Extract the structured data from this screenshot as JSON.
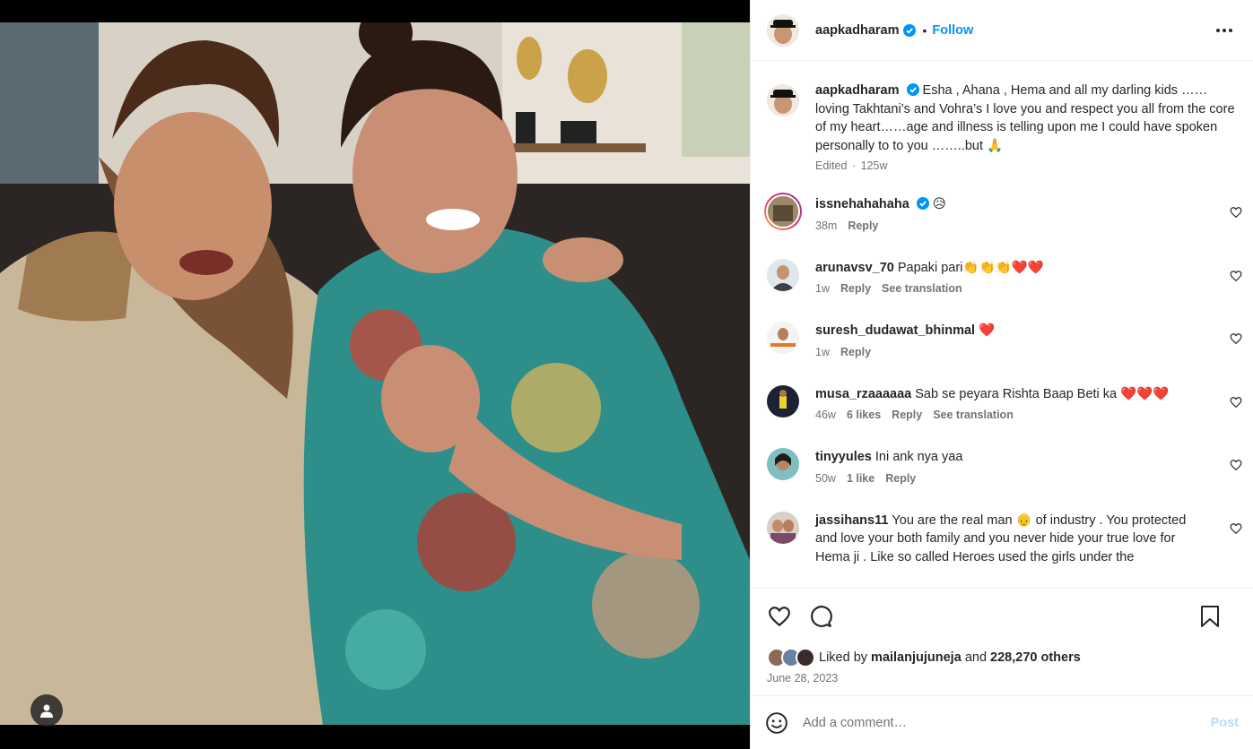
{
  "post_author": {
    "username": "aapkadharam",
    "follow_label": "Follow",
    "separator": "•"
  },
  "caption": {
    "username": "aapkadharam",
    "text": "Esha , Ahana , Hema and all my darling kids …… loving Takhtani’s and Vohra’s I love you and respect you all from the core of my heart……age and illness is telling upon me I could have spoken personally to to you ……..but 🙏",
    "edited": "Edited",
    "meta_sep": "·",
    "time": "125w"
  },
  "comments": [
    {
      "username": "issnehahahaha",
      "text": "😥",
      "time": "38m",
      "likes": "",
      "reply": "Reply",
      "translate": "",
      "verified": true
    },
    {
      "username": "arunavsv_70",
      "text": "Papaki pari👏👏👏❤️❤️",
      "time": "1w",
      "likes": "",
      "reply": "Reply",
      "translate": "See translation"
    },
    {
      "username": "suresh_dudawat_bhinmal",
      "text": "❤️",
      "time": "1w",
      "likes": "",
      "reply": "Reply",
      "translate": ""
    },
    {
      "username": "musa_rzaaaaaa",
      "text": "Sab se peyara Rishta Baap Beti ka ❤️❤️❤️",
      "time": "46w",
      "likes": "6 likes",
      "reply": "Reply",
      "translate": "See translation"
    },
    {
      "username": "tinyyules",
      "text": "Ini ank nya yaa",
      "time": "50w",
      "likes": "1 like",
      "reply": "Reply",
      "translate": ""
    },
    {
      "username": "jassihans11",
      "text": "You are the real man 👴 of industry . You protected and love your both family and you never hide your true love for Hema ji . Like so called Heroes used the girls under the",
      "time": "",
      "likes": "",
      "reply": "",
      "translate": ""
    }
  ],
  "likes": {
    "prefix": "Liked by",
    "user": "mailanjujuneja",
    "and": "and",
    "others": "228,270 others"
  },
  "date": "June 28, 2023",
  "add_comment": {
    "placeholder": "Add a comment…",
    "post_label": "Post"
  },
  "colors": {
    "accent": "#0095f6",
    "post_disabled": "#b2dffc",
    "heart": "#ed4956"
  },
  "icons": [
    "user-tag-icon",
    "verified-badge-icon",
    "more-options-icon",
    "heart-icon",
    "comment-icon",
    "bookmark-icon",
    "emoji-icon"
  ]
}
